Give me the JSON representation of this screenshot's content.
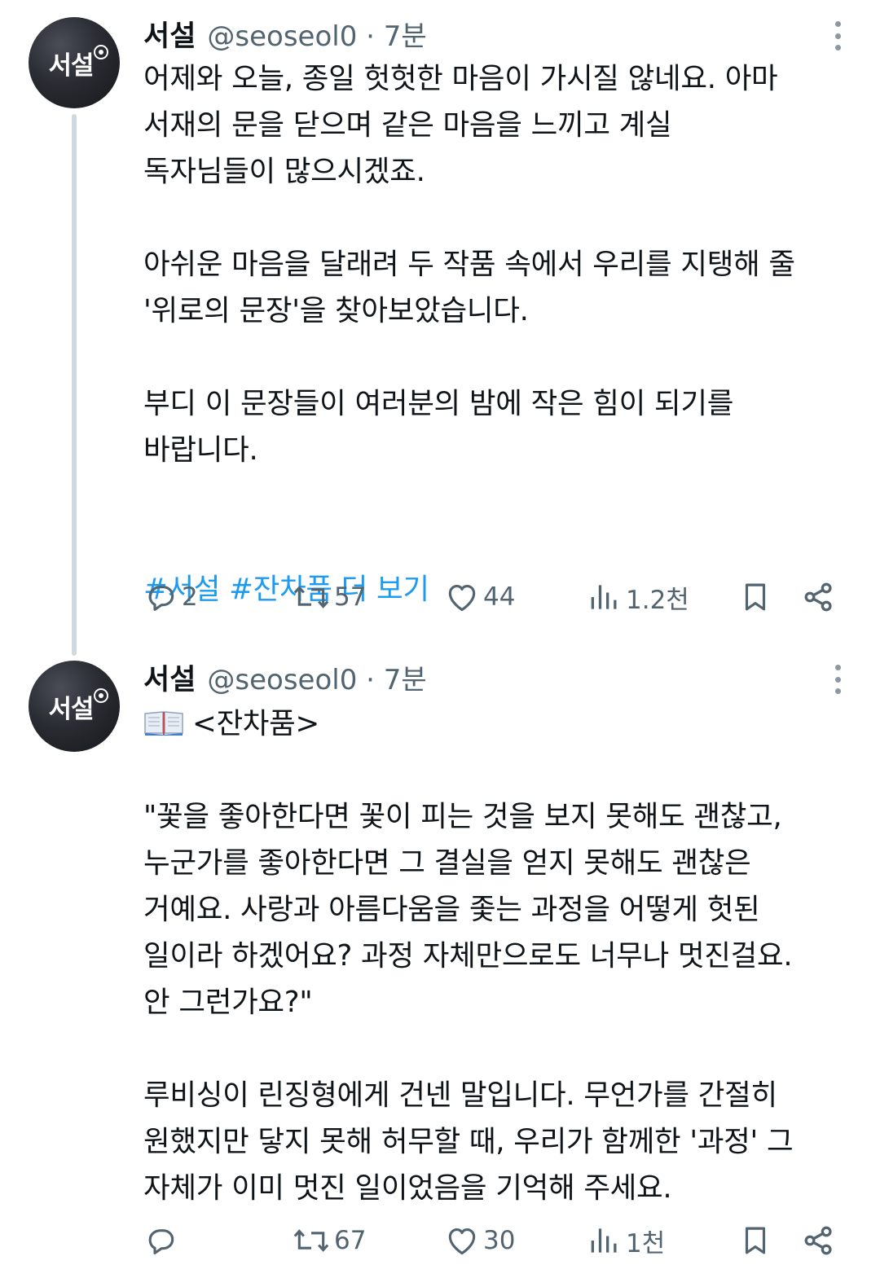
{
  "tweets": [
    {
      "author_name": "서설",
      "avatar_text": "서설",
      "handle_time": "@seoseol0 · 7분",
      "text": "어제와 오늘, 종일 헛헛한 마음이 가시질 않네요. 아마\n서재의 문을 닫으며 같은 마음을 느끼고 계실\n독자님들이 많으시겠죠.\n\n아쉬운 마음을 달래려 두 작품 속에서 우리를 지탱해 줄\n'위로의 문장'을 찾아보았습니다.\n\n부디 이 문장들이 여러분의 밤에 작은 힘이 되기를\n바랍니다.",
      "hashtags": "#서설 #잔차품 더 보기",
      "replies": "2",
      "retweets": "57",
      "likes": "44",
      "views": "1.2천"
    },
    {
      "author_name": "서설",
      "avatar_text": "서설",
      "handle_time": "@seoseol0 · 7분",
      "text_first_line": "<잔차품>",
      "text": "\n\"꽃을 좋아한다면 꽃이 피는 것을 보지 못해도 괜찮고,\n누군가를 좋아한다면 그 결실을 얻지 못해도 괜찮은\n거예요. 사랑과 아름다움을 좇는 과정을 어떻게 헛된\n일이라 하겠어요? 과정 자체만으로도 너무나 멋진걸요.\n안 그런가요?\"\n\n루비싱이 린징형에게 건넨 말입니다. 무언가를 간절히\n원했지만 닿지 못해 허무할 때, 우리가 함께한 '과정' 그\n자체가 이미 멋진 일이었음을 기억해 주세요.",
      "replies": "",
      "retweets": "67",
      "likes": "30",
      "views": "1천"
    }
  ],
  "icons": {
    "reply": "reply-icon",
    "retweet": "retweet-icon",
    "like": "heart-icon",
    "views": "views-bar-chart-icon",
    "bookmark": "bookmark-icon",
    "share": "share-icon",
    "more": "more-vertical-icon",
    "book": "open-book-emoji"
  },
  "colors": {
    "text": "#0f1419",
    "muted": "#536471",
    "link": "#1d9bf0",
    "thread_line": "#cfd9de"
  }
}
